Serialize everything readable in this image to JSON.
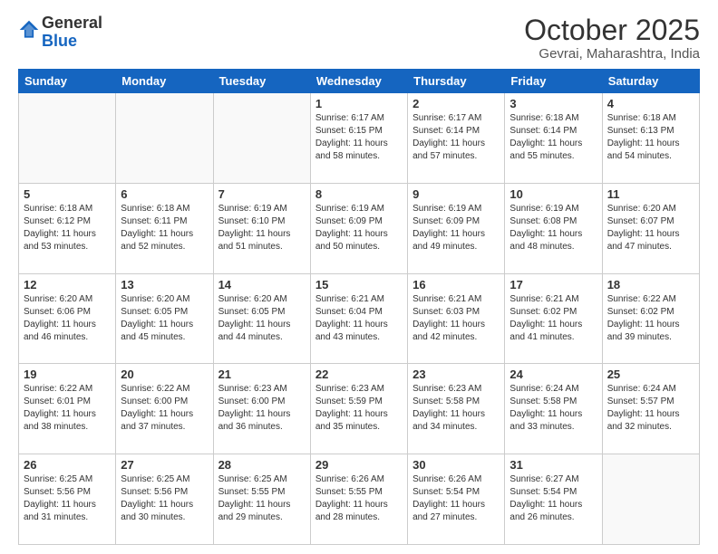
{
  "header": {
    "logo_general": "General",
    "logo_blue": "Blue",
    "month_title": "October 2025",
    "location": "Gevrai, Maharashtra, India"
  },
  "days_of_week": [
    "Sunday",
    "Monday",
    "Tuesday",
    "Wednesday",
    "Thursday",
    "Friday",
    "Saturday"
  ],
  "weeks": [
    [
      {
        "day": "",
        "info": ""
      },
      {
        "day": "",
        "info": ""
      },
      {
        "day": "",
        "info": ""
      },
      {
        "day": "1",
        "info": "Sunrise: 6:17 AM\nSunset: 6:15 PM\nDaylight: 11 hours\nand 58 minutes."
      },
      {
        "day": "2",
        "info": "Sunrise: 6:17 AM\nSunset: 6:14 PM\nDaylight: 11 hours\nand 57 minutes."
      },
      {
        "day": "3",
        "info": "Sunrise: 6:18 AM\nSunset: 6:14 PM\nDaylight: 11 hours\nand 55 minutes."
      },
      {
        "day": "4",
        "info": "Sunrise: 6:18 AM\nSunset: 6:13 PM\nDaylight: 11 hours\nand 54 minutes."
      }
    ],
    [
      {
        "day": "5",
        "info": "Sunrise: 6:18 AM\nSunset: 6:12 PM\nDaylight: 11 hours\nand 53 minutes."
      },
      {
        "day": "6",
        "info": "Sunrise: 6:18 AM\nSunset: 6:11 PM\nDaylight: 11 hours\nand 52 minutes."
      },
      {
        "day": "7",
        "info": "Sunrise: 6:19 AM\nSunset: 6:10 PM\nDaylight: 11 hours\nand 51 minutes."
      },
      {
        "day": "8",
        "info": "Sunrise: 6:19 AM\nSunset: 6:09 PM\nDaylight: 11 hours\nand 50 minutes."
      },
      {
        "day": "9",
        "info": "Sunrise: 6:19 AM\nSunset: 6:09 PM\nDaylight: 11 hours\nand 49 minutes."
      },
      {
        "day": "10",
        "info": "Sunrise: 6:19 AM\nSunset: 6:08 PM\nDaylight: 11 hours\nand 48 minutes."
      },
      {
        "day": "11",
        "info": "Sunrise: 6:20 AM\nSunset: 6:07 PM\nDaylight: 11 hours\nand 47 minutes."
      }
    ],
    [
      {
        "day": "12",
        "info": "Sunrise: 6:20 AM\nSunset: 6:06 PM\nDaylight: 11 hours\nand 46 minutes."
      },
      {
        "day": "13",
        "info": "Sunrise: 6:20 AM\nSunset: 6:05 PM\nDaylight: 11 hours\nand 45 minutes."
      },
      {
        "day": "14",
        "info": "Sunrise: 6:20 AM\nSunset: 6:05 PM\nDaylight: 11 hours\nand 44 minutes."
      },
      {
        "day": "15",
        "info": "Sunrise: 6:21 AM\nSunset: 6:04 PM\nDaylight: 11 hours\nand 43 minutes."
      },
      {
        "day": "16",
        "info": "Sunrise: 6:21 AM\nSunset: 6:03 PM\nDaylight: 11 hours\nand 42 minutes."
      },
      {
        "day": "17",
        "info": "Sunrise: 6:21 AM\nSunset: 6:02 PM\nDaylight: 11 hours\nand 41 minutes."
      },
      {
        "day": "18",
        "info": "Sunrise: 6:22 AM\nSunset: 6:02 PM\nDaylight: 11 hours\nand 39 minutes."
      }
    ],
    [
      {
        "day": "19",
        "info": "Sunrise: 6:22 AM\nSunset: 6:01 PM\nDaylight: 11 hours\nand 38 minutes."
      },
      {
        "day": "20",
        "info": "Sunrise: 6:22 AM\nSunset: 6:00 PM\nDaylight: 11 hours\nand 37 minutes."
      },
      {
        "day": "21",
        "info": "Sunrise: 6:23 AM\nSunset: 6:00 PM\nDaylight: 11 hours\nand 36 minutes."
      },
      {
        "day": "22",
        "info": "Sunrise: 6:23 AM\nSunset: 5:59 PM\nDaylight: 11 hours\nand 35 minutes."
      },
      {
        "day": "23",
        "info": "Sunrise: 6:23 AM\nSunset: 5:58 PM\nDaylight: 11 hours\nand 34 minutes."
      },
      {
        "day": "24",
        "info": "Sunrise: 6:24 AM\nSunset: 5:58 PM\nDaylight: 11 hours\nand 33 minutes."
      },
      {
        "day": "25",
        "info": "Sunrise: 6:24 AM\nSunset: 5:57 PM\nDaylight: 11 hours\nand 32 minutes."
      }
    ],
    [
      {
        "day": "26",
        "info": "Sunrise: 6:25 AM\nSunset: 5:56 PM\nDaylight: 11 hours\nand 31 minutes."
      },
      {
        "day": "27",
        "info": "Sunrise: 6:25 AM\nSunset: 5:56 PM\nDaylight: 11 hours\nand 30 minutes."
      },
      {
        "day": "28",
        "info": "Sunrise: 6:25 AM\nSunset: 5:55 PM\nDaylight: 11 hours\nand 29 minutes."
      },
      {
        "day": "29",
        "info": "Sunrise: 6:26 AM\nSunset: 5:55 PM\nDaylight: 11 hours\nand 28 minutes."
      },
      {
        "day": "30",
        "info": "Sunrise: 6:26 AM\nSunset: 5:54 PM\nDaylight: 11 hours\nand 27 minutes."
      },
      {
        "day": "31",
        "info": "Sunrise: 6:27 AM\nSunset: 5:54 PM\nDaylight: 11 hours\nand 26 minutes."
      },
      {
        "day": "",
        "info": ""
      }
    ]
  ]
}
